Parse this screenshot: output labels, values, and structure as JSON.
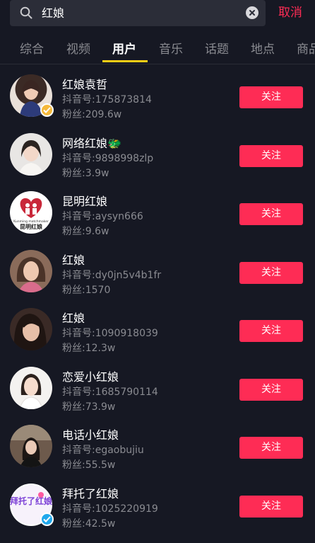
{
  "search": {
    "query": "红娘",
    "cancel_label": "取消"
  },
  "tabs": [
    {
      "label": "综合"
    },
    {
      "label": "视频"
    },
    {
      "label": "用户"
    },
    {
      "label": "音乐"
    },
    {
      "label": "话题"
    },
    {
      "label": "地点"
    },
    {
      "label": "商品"
    }
  ],
  "active_tab": "用户",
  "users": [
    {
      "name": "红娘袁哲",
      "douyin_id": "抖音号:175873814",
      "fans": "粉丝:209.6w",
      "follow_label": "关注",
      "verified": "gold"
    },
    {
      "name": "网络红娘🐲",
      "douyin_id": "抖音号:9898998zlp",
      "fans": "粉丝:3.9w",
      "follow_label": "关注",
      "verified": ""
    },
    {
      "name": "昆明红娘",
      "douyin_id": "抖音号:aysyn666",
      "fans": "粉丝:9.6w",
      "follow_label": "关注",
      "verified": "",
      "avatar_text": "昆明红娘",
      "avatar_subtext": "Kunming matchmaker"
    },
    {
      "name": "红娘",
      "douyin_id": "抖音号:dy0jn5v4b1fr",
      "fans": "粉丝:1570",
      "follow_label": "关注",
      "verified": ""
    },
    {
      "name": "红娘",
      "douyin_id": "抖音号:1090918039",
      "fans": "粉丝:12.3w",
      "follow_label": "关注",
      "verified": ""
    },
    {
      "name": "恋爱小红娘",
      "douyin_id": "抖音号:1685790114",
      "fans": "粉丝:73.9w",
      "follow_label": "关注",
      "verified": ""
    },
    {
      "name": "电话小红娘",
      "douyin_id": "抖音号:egaobujiu",
      "fans": "粉丝:55.5w",
      "follow_label": "关注",
      "verified": ""
    },
    {
      "name": "拜托了红娘",
      "douyin_id": "抖音号:1025220919",
      "fans": "粉丝:42.5w",
      "follow_label": "关注",
      "verified": "blue",
      "avatar_text": "拜托了红娘"
    }
  ],
  "colors": {
    "accent": "#fe2c55",
    "tab_indicator": "#face15",
    "background": "#161823",
    "verified_gold": "#f5b93b",
    "verified_blue": "#20d5ec"
  },
  "icons": {
    "search": "search-icon",
    "clear": "clear-icon",
    "verified": "check-icon"
  }
}
